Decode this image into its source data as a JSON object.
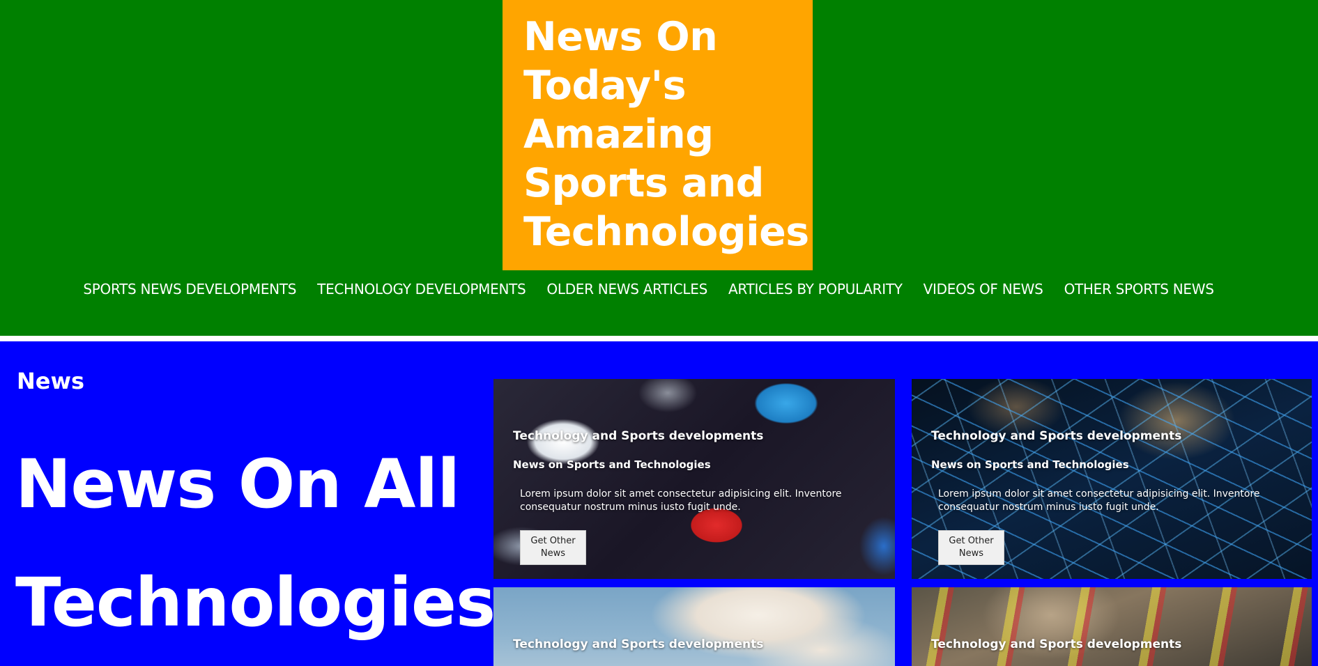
{
  "header": {
    "title": "News On Today's Amazing Sports and Technologies",
    "background_color": "#008000",
    "title_box_color": "#ffa500"
  },
  "nav": {
    "items": [
      {
        "label": "SPORTS NEWS DEVELOPMENTS"
      },
      {
        "label": "TECHNOLOGY DEVELOPMENTS"
      },
      {
        "label": "OLDER NEWS ARTICLES"
      },
      {
        "label": "ARTICLES BY POPULARITY"
      },
      {
        "label": "VIDEOS OF NEWS"
      },
      {
        "label": "OTHER SPORTS NEWS"
      }
    ]
  },
  "main": {
    "background_color": "#0000ff",
    "eyebrow": "News",
    "hero_line1": "News On All",
    "hero_line2": "Technologies",
    "cards": [
      {
        "kicker": "Technology and Sports developments",
        "title": "News on Sports and Technologies",
        "description": "Lorem ipsum dolor sit amet consectetur adipisicing elit. Inventore consequatur nostrum minus iusto fugit unde.",
        "button_label": "Get Other News",
        "image": "app-icons-photo"
      },
      {
        "kicker": "Technology and Sports developments",
        "title": "News on Sports and Technologies",
        "description": "Lorem ipsum dolor sit amet consectetur adipisicing elit. Inventore consequatur nostrum minus iusto fugit unde.",
        "button_label": "Get Other News",
        "image": "network-city-photo"
      },
      {
        "kicker": "Technology and Sports developments",
        "image": "sky-clouds-photo"
      },
      {
        "kicker": "Technology and Sports developments",
        "image": "circuit-board-photo"
      }
    ]
  }
}
